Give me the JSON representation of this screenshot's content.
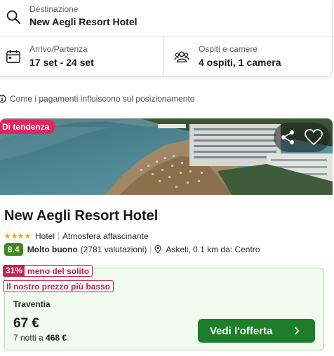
{
  "search": {
    "destination_label": "Destinazione",
    "destination_value": "New Aegli Resort Hotel",
    "dates_label": "Arrivo/Partenza",
    "dates_value": "17 set - 24 set",
    "guests_label": "Ospiti e camere",
    "guests_value": "4 ospiti, 1 camera",
    "icons": [
      "search-icon",
      "calendar-icon",
      "guests-icon"
    ]
  },
  "info": {
    "text": "Come i pagamenti influiscono sul posizionamento",
    "icon": "info-icon"
  },
  "hotel": {
    "trend_badge": "Di tendenza",
    "name": "New Aegli Resort Hotel",
    "stars": 4,
    "type": "Hotel",
    "atmosphere": "Atmosfera affascinante",
    "score": "8.4",
    "score_label": "Molto buono",
    "reviews": "(2781 valutazioni)",
    "location": "Askeli, 0.1 km da: Centro",
    "actions": [
      "share-icon",
      "heart-icon"
    ]
  },
  "deal": {
    "discount_pct": "31%",
    "discount_text": "meno del solito",
    "best_price": "Il nostro prezzo più basso",
    "provider": "Traventia",
    "price": "67 €",
    "nights_prefix": "7 notti a",
    "nights_total": "468 €",
    "cta_label": "Vedi l'offerta"
  },
  "colors": {
    "trend": "#e0245e",
    "discount": "#c4234d",
    "score": "#3a8a1f",
    "cta": "#1e7d2b",
    "deal_bg": "#f0faef",
    "deal_border": "#b6deb1"
  }
}
